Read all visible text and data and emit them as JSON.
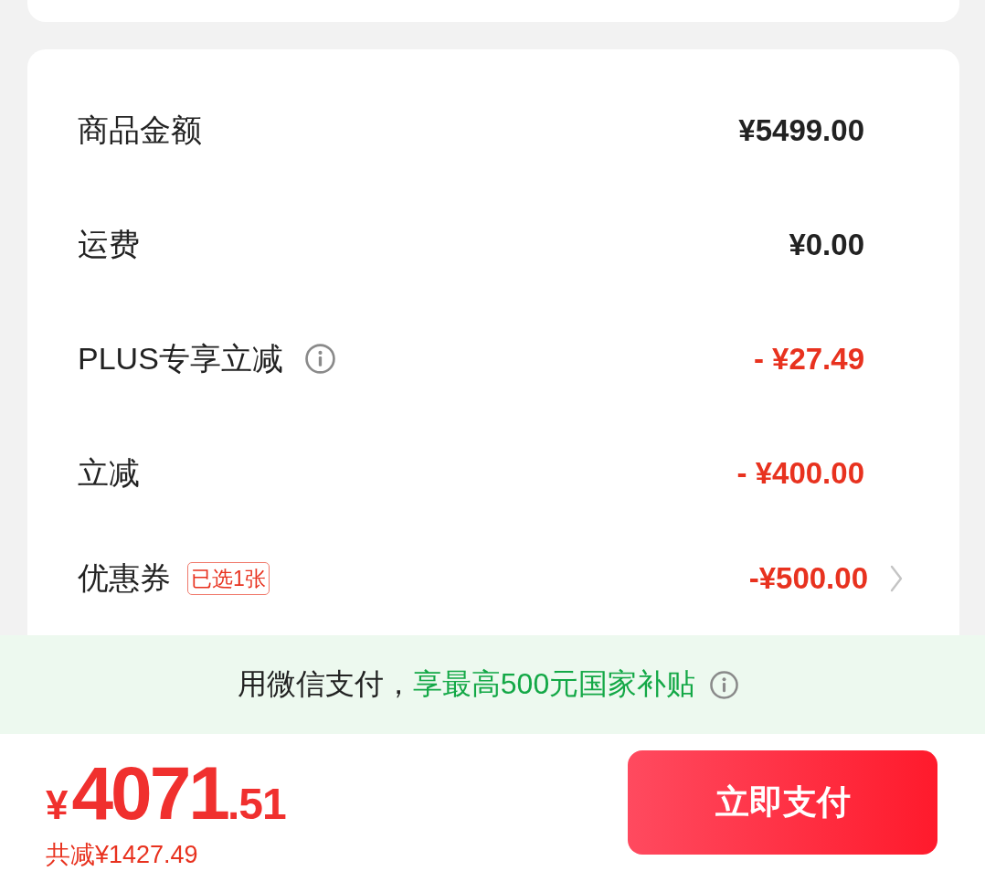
{
  "summary": {
    "rows": [
      {
        "label": "商品金额",
        "value": "¥5499.00",
        "kind": "charge",
        "info": false
      },
      {
        "label": "运费",
        "value": "¥0.00",
        "kind": "charge",
        "info": false
      },
      {
        "label": "PLUS专享立减",
        "value": "- ¥27.49",
        "kind": "discount",
        "info": true
      },
      {
        "label": "立减",
        "value": "- ¥400.00",
        "kind": "discount",
        "info": false
      },
      {
        "label": "优惠券",
        "badge": "已选1张",
        "value": "-¥500.00",
        "kind": "coupon",
        "info": false
      }
    ]
  },
  "banner": {
    "text": "用微信支付，",
    "highlight": "享最高500元国家补贴",
    "info": true
  },
  "footer": {
    "total": {
      "currency": "¥",
      "integer": "4071",
      "decimal": ".51"
    },
    "saved": "共减¥1427.49",
    "pay_button": "立即支付"
  }
}
